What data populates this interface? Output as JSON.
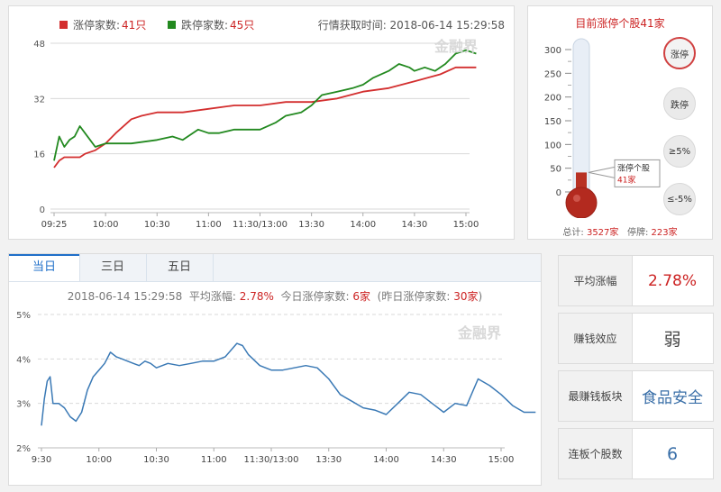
{
  "colors": {
    "red": "#d32f2f",
    "green": "#22891f",
    "blue": "#3a79b5",
    "value_red": "#cc2222",
    "value_blue": "#3a6fa8"
  },
  "top": {
    "legend_up_prefix": "涨停家数:",
    "legend_up_value": "41只",
    "legend_down_prefix": "跌停家数:",
    "legend_down_value": "45只",
    "fetch_time": "行情获取时间: 2018-06-14 15:29:58",
    "watermark": "金融界"
  },
  "thermometer": {
    "title": "目前涨停个股41家",
    "ticks": [
      "300",
      "250",
      "200",
      "150",
      "100",
      "50",
      "0"
    ],
    "tooltip_line1": "涨停个股",
    "tooltip_line2": "41家",
    "level": 41,
    "level_max": 300,
    "buttons": [
      {
        "label": "涨停",
        "active": true
      },
      {
        "label": "跌停",
        "active": false
      },
      {
        "label": "≥5%",
        "active": false
      },
      {
        "label": "≤-5%",
        "active": false
      }
    ],
    "footer_total_label": "总计:",
    "footer_total_value": "3527家",
    "footer_suspend_label": "停牌:",
    "footer_suspend_value": "223家"
  },
  "bottom": {
    "tabs": [
      "当日",
      "三日",
      "五日"
    ],
    "active_tab": 0,
    "info_time": "2018-06-14 15:29:58",
    "info_avg_label": "平均涨幅:",
    "info_avg_value": "2.78%",
    "info_today_label": "今日涨停家数:",
    "info_today_value": "6家",
    "info_yest_label": "(昨日涨停家数:",
    "info_yest_value": "30家",
    "info_yest_close": ")",
    "watermark": "金融界"
  },
  "cards": [
    {
      "label": "平均涨幅",
      "value": "2.78%",
      "color": "#cc2222",
      "size": 17
    },
    {
      "label": "赚钱效应",
      "value": "弱",
      "color": "#444444",
      "size": 19
    },
    {
      "label": "最赚钱板块",
      "value": "食品安全",
      "color": "#3a6fa8",
      "size": 17
    },
    {
      "label": "连板个股数",
      "value": "6",
      "color": "#3a6fa8",
      "size": 19
    }
  ],
  "chart_data": [
    {
      "type": "line",
      "title": "",
      "ylim": [
        0,
        48
      ],
      "yticks": [
        "0",
        "16",
        "32",
        "48"
      ],
      "xlabels": [
        "09:25",
        "10:00",
        "10:30",
        "11:00",
        "11:30/13:00",
        "13:30",
        "14:00",
        "14:30",
        "15:00"
      ],
      "series": [
        {
          "name": "涨停家数",
          "color": "#d32f2f",
          "points": [
            [
              0,
              12
            ],
            [
              0.1,
              14
            ],
            [
              0.2,
              15
            ],
            [
              0.3,
              15
            ],
            [
              0.5,
              15
            ],
            [
              0.6,
              16
            ],
            [
              0.8,
              17
            ],
            [
              1.0,
              19
            ],
            [
              1.2,
              22
            ],
            [
              1.5,
              26
            ],
            [
              1.7,
              27
            ],
            [
              2.0,
              28
            ],
            [
              2.5,
              28
            ],
            [
              3.0,
              29
            ],
            [
              3.5,
              30
            ],
            [
              4.0,
              30
            ],
            [
              4.5,
              31
            ],
            [
              5.0,
              31
            ],
            [
              5.5,
              32
            ],
            [
              6.0,
              34
            ],
            [
              6.5,
              35
            ],
            [
              7.0,
              37
            ],
            [
              7.5,
              39
            ],
            [
              7.8,
              41
            ],
            [
              8.0,
              41
            ],
            [
              8.2,
              41
            ]
          ]
        },
        {
          "name": "跌停家数",
          "color": "#22891f",
          "points": [
            [
              0,
              14
            ],
            [
              0.1,
              21
            ],
            [
              0.2,
              18
            ],
            [
              0.3,
              20
            ],
            [
              0.4,
              21
            ],
            [
              0.5,
              24
            ],
            [
              0.6,
              22
            ],
            [
              0.7,
              20
            ],
            [
              0.8,
              18
            ],
            [
              1.0,
              19
            ],
            [
              1.5,
              19
            ],
            [
              2.0,
              20
            ],
            [
              2.3,
              21
            ],
            [
              2.5,
              20
            ],
            [
              2.8,
              23
            ],
            [
              3.0,
              22
            ],
            [
              3.2,
              22
            ],
            [
              3.5,
              23
            ],
            [
              4.0,
              23
            ],
            [
              4.3,
              25
            ],
            [
              4.5,
              27
            ],
            [
              4.8,
              28
            ],
            [
              5.0,
              30
            ],
            [
              5.2,
              33
            ],
            [
              5.5,
              34
            ],
            [
              5.8,
              35
            ],
            [
              6.0,
              36
            ],
            [
              6.2,
              38
            ],
            [
              6.5,
              40
            ],
            [
              6.7,
              42
            ],
            [
              6.9,
              41
            ],
            [
              7.0,
              40
            ],
            [
              7.2,
              41
            ],
            [
              7.4,
              40
            ],
            [
              7.6,
              42
            ],
            [
              7.8,
              45
            ],
            [
              8.0,
              46
            ],
            [
              8.2,
              45
            ]
          ]
        }
      ]
    },
    {
      "type": "line",
      "title": "",
      "ylim": [
        2,
        5
      ],
      "yticks": [
        "2%",
        "3%",
        "4%",
        "5%"
      ],
      "xlabels": [
        "9:30",
        "10:00",
        "10:30",
        "11:00",
        "11:30/13:00",
        "13:30",
        "14:00",
        "14:30",
        "15:00"
      ],
      "series": [
        {
          "name": "平均涨幅",
          "color": "#3a79b5",
          "points": [
            [
              0,
              2.5
            ],
            [
              0.05,
              3.1
            ],
            [
              0.1,
              3.5
            ],
            [
              0.15,
              3.6
            ],
            [
              0.2,
              3.0
            ],
            [
              0.3,
              3.0
            ],
            [
              0.4,
              2.9
            ],
            [
              0.5,
              2.7
            ],
            [
              0.6,
              2.6
            ],
            [
              0.7,
              2.8
            ],
            [
              0.8,
              3.3
            ],
            [
              0.9,
              3.6
            ],
            [
              1.0,
              3.75
            ],
            [
              1.1,
              3.9
            ],
            [
              1.2,
              4.15
            ],
            [
              1.3,
              4.05
            ],
            [
              1.4,
              4.0
            ],
            [
              1.5,
              3.95
            ],
            [
              1.6,
              3.9
            ],
            [
              1.7,
              3.85
            ],
            [
              1.8,
              3.95
            ],
            [
              1.9,
              3.9
            ],
            [
              2.0,
              3.8
            ],
            [
              2.2,
              3.9
            ],
            [
              2.4,
              3.85
            ],
            [
              2.6,
              3.9
            ],
            [
              2.8,
              3.95
            ],
            [
              3.0,
              3.95
            ],
            [
              3.2,
              4.05
            ],
            [
              3.4,
              4.35
            ],
            [
              3.5,
              4.3
            ],
            [
              3.6,
              4.1
            ],
            [
              3.8,
              3.85
            ],
            [
              4.0,
              3.75
            ],
            [
              4.2,
              3.75
            ],
            [
              4.4,
              3.8
            ],
            [
              4.6,
              3.85
            ],
            [
              4.8,
              3.8
            ],
            [
              5.0,
              3.55
            ],
            [
              5.2,
              3.2
            ],
            [
              5.4,
              3.05
            ],
            [
              5.6,
              2.9
            ],
            [
              5.8,
              2.85
            ],
            [
              6.0,
              2.75
            ],
            [
              6.2,
              3.0
            ],
            [
              6.4,
              3.25
            ],
            [
              6.6,
              3.2
            ],
            [
              6.8,
              3.0
            ],
            [
              7.0,
              2.8
            ],
            [
              7.2,
              3.0
            ],
            [
              7.4,
              2.95
            ],
            [
              7.6,
              3.55
            ],
            [
              7.8,
              3.4
            ],
            [
              8.0,
              3.2
            ],
            [
              8.2,
              2.95
            ],
            [
              8.4,
              2.8
            ],
            [
              8.6,
              2.8
            ]
          ]
        }
      ]
    }
  ]
}
